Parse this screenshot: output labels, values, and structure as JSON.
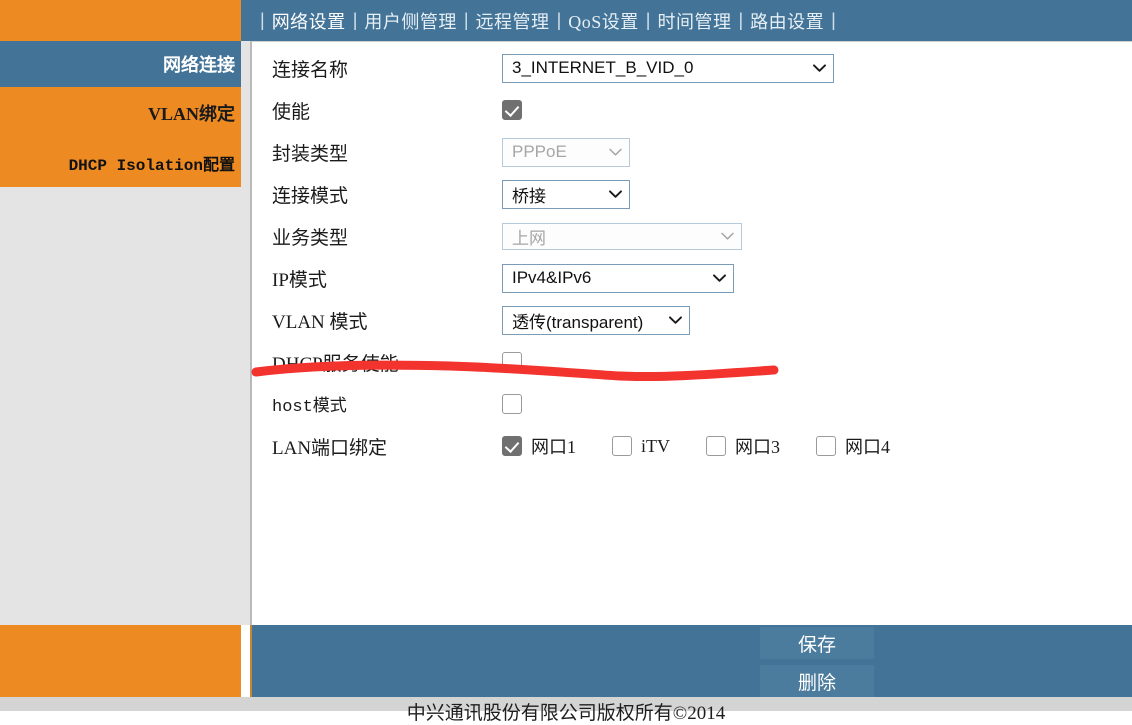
{
  "theme": {
    "orange": "#ED8B22",
    "blue": "#437396",
    "panel_bg": "#ffffff",
    "sidebar_bg": "#e4e4e4",
    "annotation_red": "#F2332E"
  },
  "nav": {
    "separator": "|",
    "tabs": [
      {
        "label": "网络设置",
        "active": true
      },
      {
        "label": "用户侧管理",
        "active": false
      },
      {
        "label": "远程管理",
        "active": false
      },
      {
        "label": "QoS设置",
        "active": false
      },
      {
        "label": "时间管理",
        "active": false
      },
      {
        "label": "路由设置",
        "active": false
      }
    ]
  },
  "sidebar": {
    "items": [
      {
        "label": "网络连接",
        "active": true
      },
      {
        "label": "VLAN绑定",
        "active": false
      },
      {
        "label": "DHCP Isolation配置",
        "active": false
      }
    ]
  },
  "form": {
    "connection_name": {
      "label": "连接名称",
      "value": "3_INTERNET_B_VID_0",
      "icon": "chevron-down-icon",
      "disabled": false
    },
    "enable": {
      "label": "使能",
      "checked": true
    },
    "encapsulation_type": {
      "label": "封装类型",
      "value": "PPPoE",
      "icon": "chevron-down-icon",
      "disabled": true
    },
    "connection_mode": {
      "label": "连接模式",
      "value": "桥接",
      "icon": "chevron-down-icon",
      "disabled": false
    },
    "service_type": {
      "label": "业务类型",
      "value": "上网",
      "icon": "chevron-down-icon",
      "disabled": true
    },
    "ip_mode": {
      "label": "IP模式",
      "value": "IPv4&IPv6",
      "icon": "chevron-down-icon",
      "disabled": false
    },
    "vlan_mode": {
      "label": "VLAN 模式",
      "value": "透传(transparent)",
      "icon": "chevron-down-icon",
      "disabled": false
    },
    "dhcp_service_enable": {
      "label": "DHCP服务使能",
      "checked": false
    },
    "host_mode": {
      "label": "host模式",
      "checked": false
    },
    "lan_port_binding": {
      "label": "LAN端口绑定",
      "ports": [
        {
          "label": "网口1",
          "checked": true
        },
        {
          "label": "iTV",
          "checked": false
        },
        {
          "label": "网口3",
          "checked": false
        },
        {
          "label": "网口4",
          "checked": false
        }
      ]
    }
  },
  "annotation": {
    "type": "hand-drawn-underline",
    "color": "#F2332E",
    "target": "VLAN 模式"
  },
  "actions": {
    "save_label": "保存",
    "delete_label": "删除"
  },
  "footer": {
    "text": "中兴通讯股份有限公司版权所有©2014"
  }
}
